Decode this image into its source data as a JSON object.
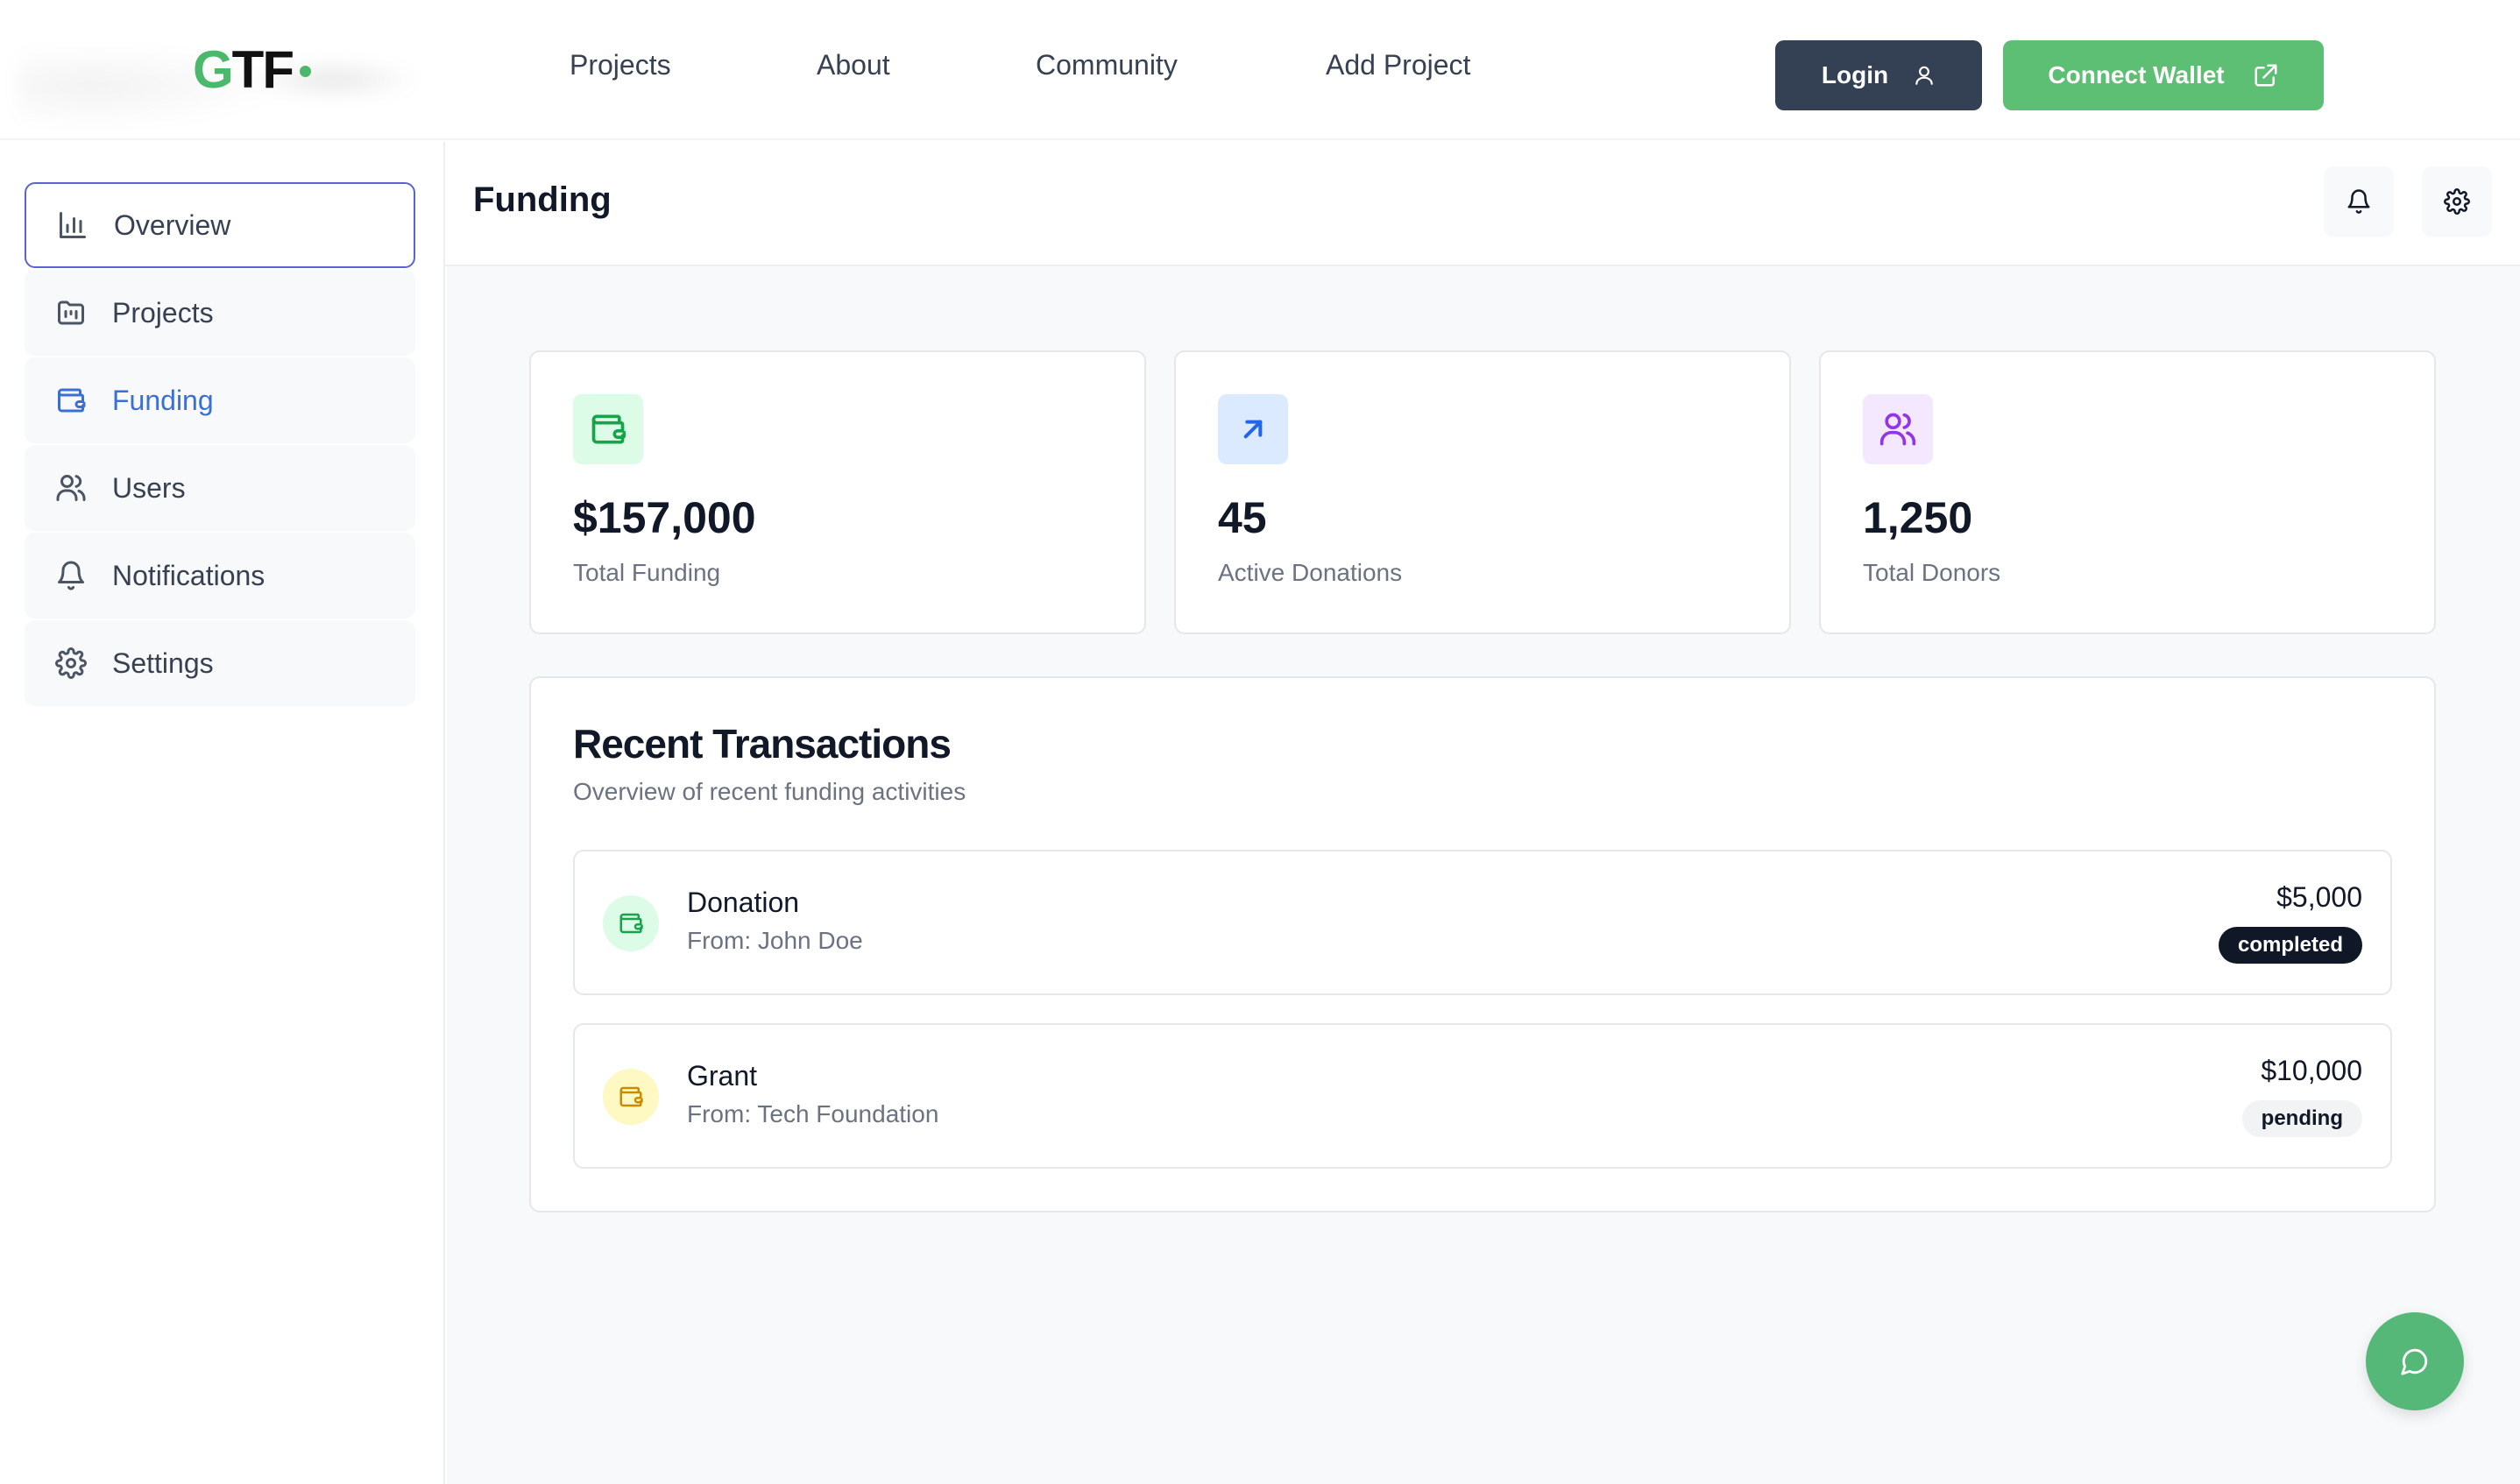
{
  "brand": {
    "logo_g": "G",
    "logo_tf": "TF"
  },
  "nav": {
    "links": [
      {
        "label": "Projects"
      },
      {
        "label": "About"
      },
      {
        "label": "Community"
      },
      {
        "label": "Add Project"
      }
    ],
    "login_label": "Login",
    "connect_wallet_label": "Connect Wallet"
  },
  "sidebar": {
    "items": [
      {
        "label": "Overview",
        "icon": "bar-chart-icon",
        "state": "focused"
      },
      {
        "label": "Projects",
        "icon": "folder-kanban-icon"
      },
      {
        "label": "Funding",
        "icon": "wallet-icon",
        "state": "selected"
      },
      {
        "label": "Users",
        "icon": "users-icon"
      },
      {
        "label": "Notifications",
        "icon": "bell-icon"
      },
      {
        "label": "Settings",
        "icon": "gear-icon"
      }
    ]
  },
  "header": {
    "title": "Funding"
  },
  "stats": [
    {
      "value": "$157,000",
      "label": "Total Funding",
      "icon": "wallet-icon",
      "color": "#16a34a"
    },
    {
      "value": "45",
      "label": "Active Donations",
      "icon": "arrow-up-right-icon",
      "color": "#2563eb"
    },
    {
      "value": "1,250",
      "label": "Total Donors",
      "icon": "users-icon",
      "color": "#9333ea"
    }
  ],
  "transactions": {
    "title": "Recent Transactions",
    "subtitle": "Overview of recent funding activities",
    "items": [
      {
        "type": "Donation",
        "from": "From: John Doe",
        "amount": "$5,000",
        "status": "completed"
      },
      {
        "type": "Grant",
        "from": "From: Tech Foundation",
        "amount": "$10,000",
        "status": "pending"
      }
    ]
  },
  "colors": {
    "brand_green": "#4cb86c",
    "login_bg": "#344154",
    "wallet_bg": "#5cbf73",
    "active_border": "#5b63d3",
    "funding_blue": "#3b6fd8"
  }
}
